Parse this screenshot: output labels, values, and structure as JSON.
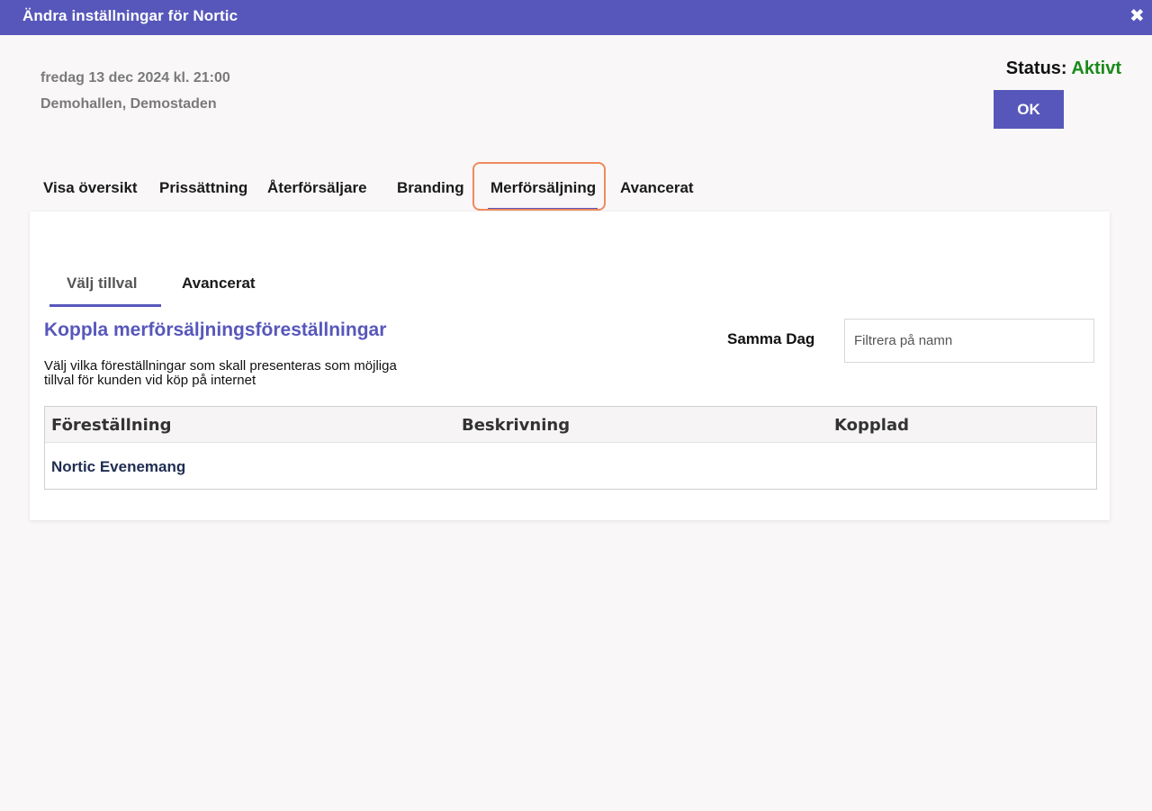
{
  "window": {
    "title": "Ändra inställningar för Nortic",
    "close_glyph": "✖"
  },
  "event": {
    "date": "fredag 13 dec 2024 kl. 21:00",
    "venue": "Demohallen, Demostaden"
  },
  "status": {
    "label": "Status:",
    "value": "Aktivt",
    "value_color": "#1a8a1a"
  },
  "ok_button": {
    "label": "OK"
  },
  "tabs": [
    {
      "label": "Visa översikt",
      "active": false
    },
    {
      "label": "Prissättning",
      "active": false
    },
    {
      "label": "Återförsäljare",
      "active": false
    },
    {
      "label": "Branding",
      "active": false
    },
    {
      "label": "Merförsäljning",
      "active": true
    },
    {
      "label": "Avancerat",
      "active": false
    }
  ],
  "subtabs": [
    {
      "label": "Välj tillval",
      "active": true
    },
    {
      "label": "Avancerat",
      "active": false
    }
  ],
  "section": {
    "title": "Koppla merförsäljningsföreställningar",
    "description": "Välj vilka föreställningar som skall presenteras som möjliga tillval för kunden vid köp på internet"
  },
  "filter": {
    "label": "Samma Dag",
    "placeholder": "Filtrera på namn",
    "value": ""
  },
  "table": {
    "columns": [
      "Föreställning",
      "Beskrivning",
      "Kopplad"
    ],
    "rows": [
      {
        "name": "Nortic Evenemang",
        "description": "",
        "linked": ""
      }
    ]
  },
  "colors": {
    "accent": "#5757bb",
    "highlight_frame": "#f08a5d",
    "background": "#f9f7f8"
  }
}
